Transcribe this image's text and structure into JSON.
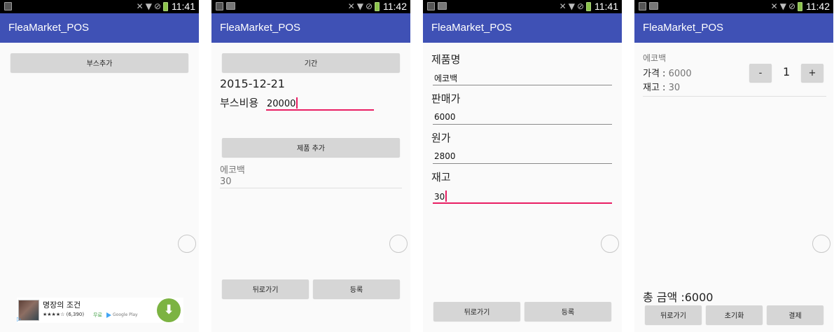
{
  "status": {
    "time_1": "11:41",
    "time_2": "11:42",
    "time_3": "11:41",
    "time_4": "11:42"
  },
  "app": {
    "title": "FleaMarket_POS"
  },
  "screen1": {
    "add_booth_button": "부스추가",
    "ad": {
      "title": "명장의 조건",
      "rating": "★★★★☆ (6,390)",
      "price": "무료",
      "store": "Google Play",
      "download_icon": "download-icon"
    }
  },
  "screen2": {
    "period_button": "기간",
    "date": "2015-12-21",
    "booth_cost_label": "부스비용",
    "booth_cost_value": "20000",
    "add_product_button": "제품 추가",
    "product_name": "에코백",
    "product_stock": "30",
    "back_button": "뒤로가기",
    "register_button": "등록"
  },
  "screen3": {
    "name_label": "제품명",
    "name_value": "에코백",
    "price_label": "판매가",
    "price_value": "6000",
    "cost_label": "원가",
    "cost_value": "2800",
    "stock_label": "재고",
    "stock_value": "30",
    "back_button": "뒤로가기",
    "register_button": "등록"
  },
  "screen4": {
    "product_name": "에코백",
    "price_label": "가격 : ",
    "price_value": "6000",
    "stock_label": "재고 : ",
    "stock_value": "30",
    "minus_button": "-",
    "quantity": "1",
    "plus_button": "+",
    "total_label": "총 금액 :6000",
    "back_button": "뒤로가기",
    "reset_button": "초기화",
    "pay_button": "결제"
  },
  "colors": {
    "appbar": "#3f51b5",
    "accent": "#e91e63",
    "button": "#d6d6d6"
  }
}
